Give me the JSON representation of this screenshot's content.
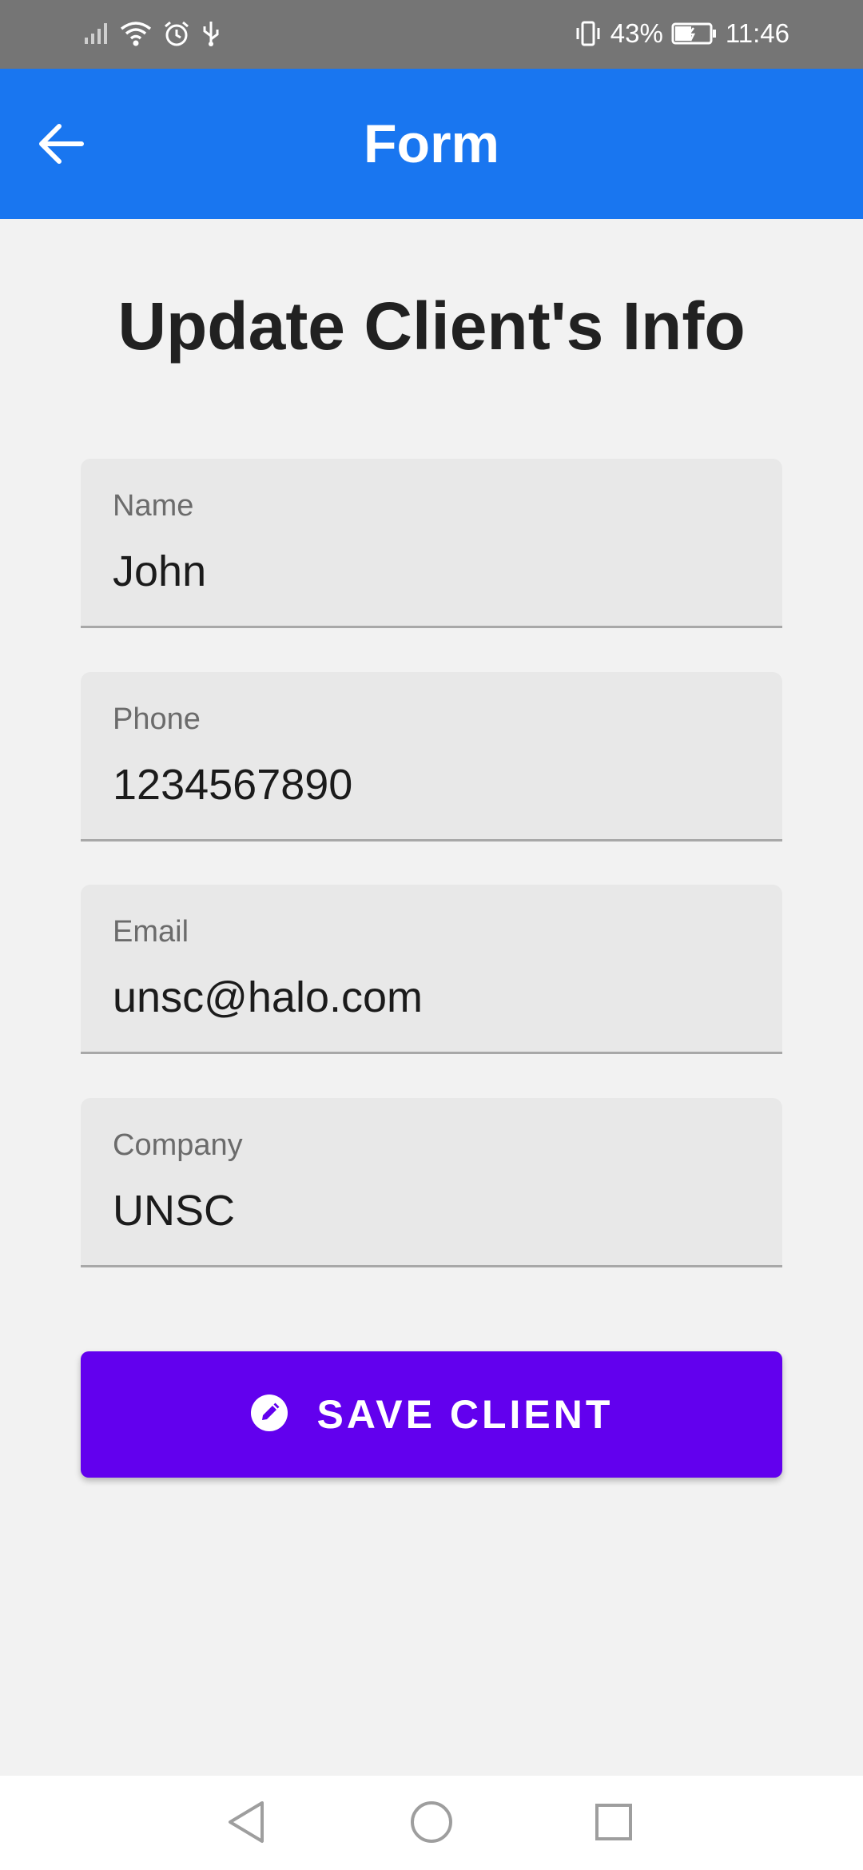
{
  "status_bar": {
    "battery": "43%",
    "time": "11:46"
  },
  "app_bar": {
    "title": "Form"
  },
  "heading": "Update Client's Info",
  "form": {
    "fields": [
      {
        "label": "Name",
        "value": "John"
      },
      {
        "label": "Phone",
        "value": "1234567890"
      },
      {
        "label": "Email",
        "value": "unsc@halo.com"
      },
      {
        "label": "Company",
        "value": "UNSC"
      }
    ],
    "save_label": "SAVE CLIENT"
  },
  "colors": {
    "status_bar": "#757575",
    "app_bar": "#1976f0",
    "save_button": "#6200ee",
    "field_bg": "#e8e8e8",
    "page_bg": "#f2f2f2"
  }
}
